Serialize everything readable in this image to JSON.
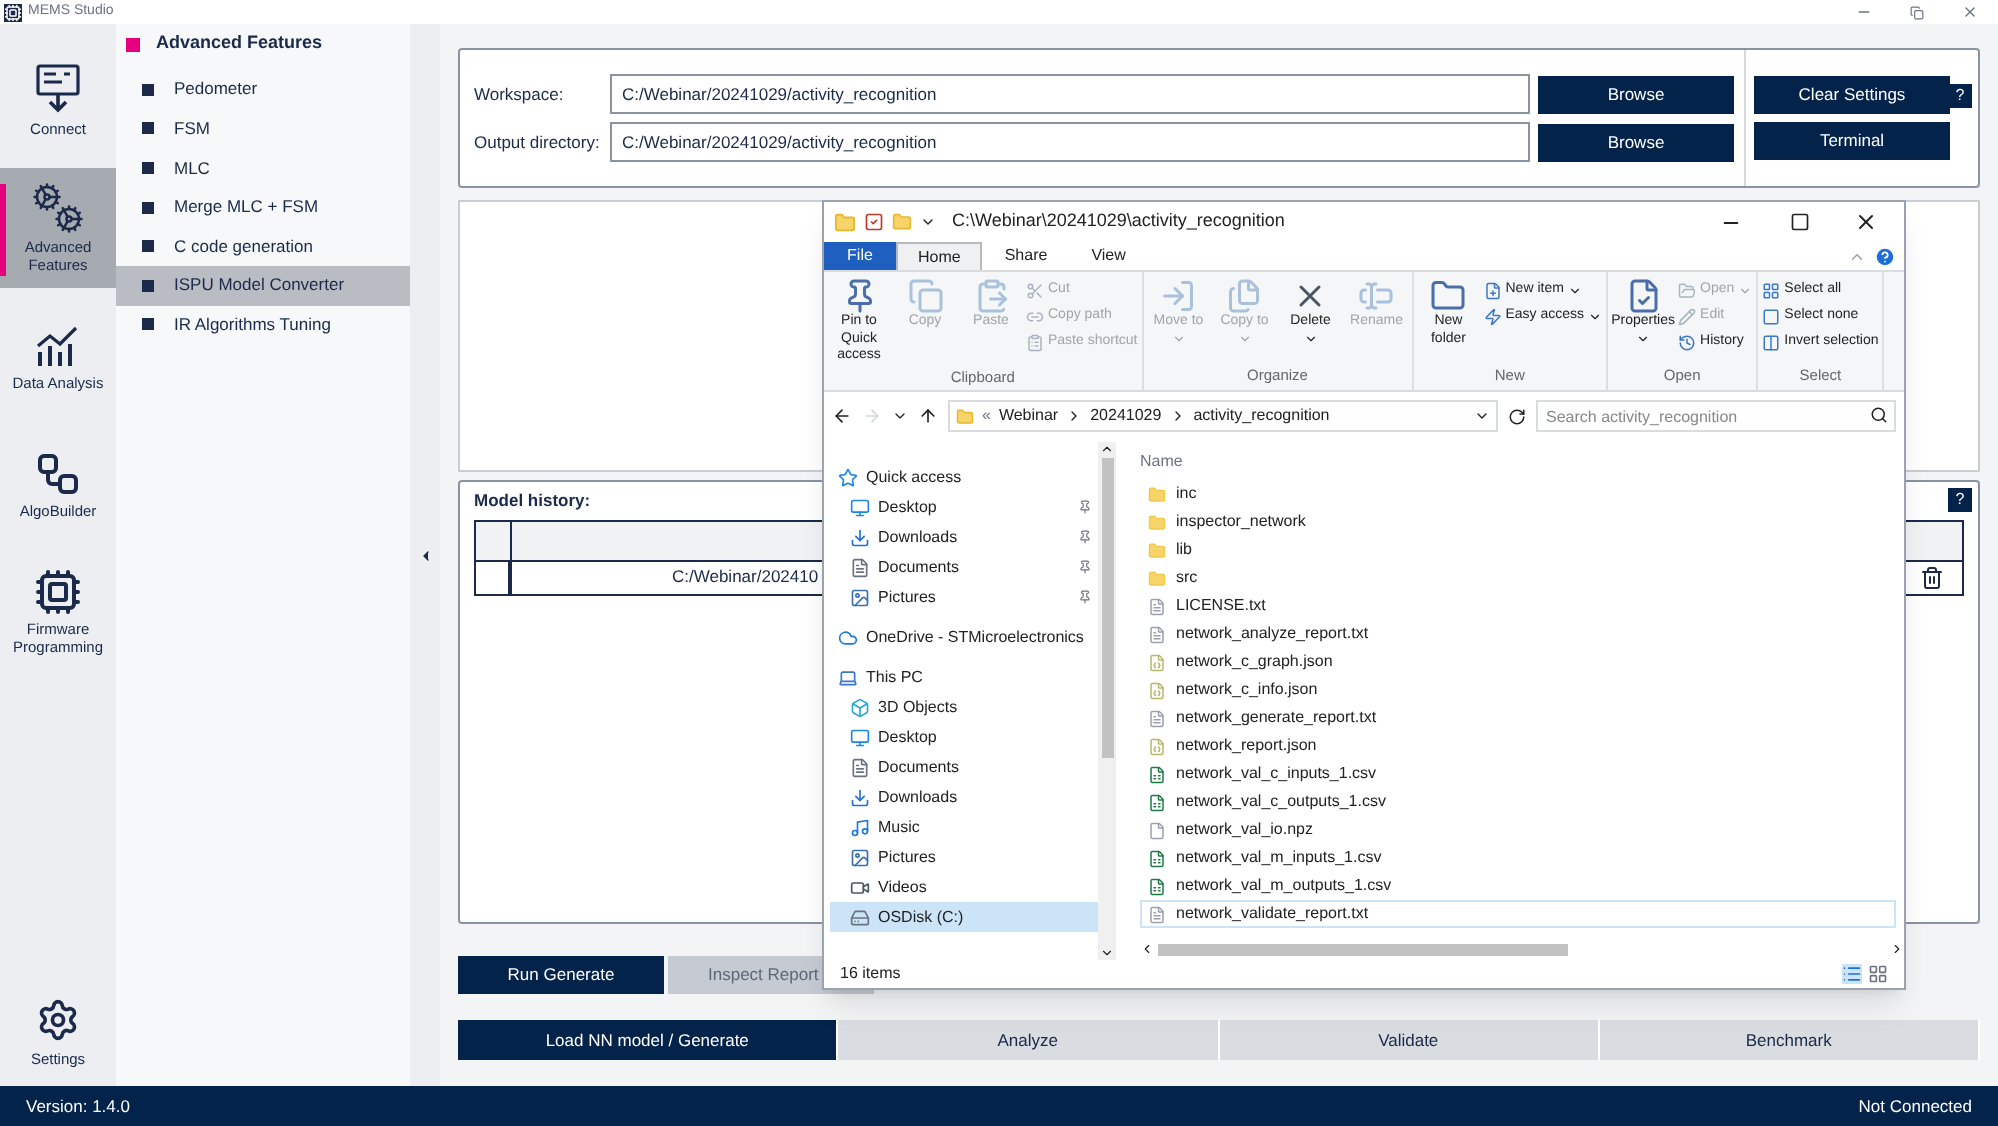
{
  "app_title": "MEMS Studio",
  "rail": [
    {
      "label": "Connect",
      "kind": "connect",
      "selected": false
    },
    {
      "label": "Advanced Features",
      "kind": "gears",
      "selected": true
    },
    {
      "label": "Data Analysis",
      "kind": "chart",
      "selected": false
    },
    {
      "label": "AlgoBuilder",
      "kind": "tree",
      "selected": false
    },
    {
      "label": "Firmware Programming",
      "kind": "chip",
      "selected": false
    }
  ],
  "settings": {
    "label": "Settings"
  },
  "submenu": {
    "title": "Advanced Features",
    "items": [
      {
        "label": "Pedometer",
        "selected": false
      },
      {
        "label": "FSM",
        "selected": false
      },
      {
        "label": "MLC",
        "selected": false
      },
      {
        "label": "Merge MLC + FSM",
        "selected": false
      },
      {
        "label": "C code generation",
        "selected": false
      },
      {
        "label": "ISPU Model Converter",
        "selected": true
      },
      {
        "label": "IR Algorithms Tuning",
        "selected": false
      }
    ]
  },
  "workspace": {
    "fields": [
      {
        "label": "Workspace:",
        "value": "C:/Webinar/20241029/activity_recognition",
        "button": "Browse"
      },
      {
        "label": "Output directory:",
        "value": "C:/Webinar/20241029/activity_recognition",
        "button": "Browse"
      }
    ],
    "side_buttons": [
      "Clear Settings",
      "Terminal"
    ],
    "help": "?"
  },
  "model_history": {
    "title": "Model history:",
    "help": "?",
    "rows": [
      {
        "path": "C:/Webinar/202410"
      }
    ]
  },
  "actions": [
    {
      "label": "Run Generate",
      "disabled": false
    },
    {
      "label": "Inspect Report",
      "disabled": true
    }
  ],
  "tabs": [
    {
      "label": "Load NN model / Generate",
      "selected": true
    },
    {
      "label": "Analyze",
      "selected": false
    },
    {
      "label": "Validate",
      "selected": false
    },
    {
      "label": "Benchmark",
      "selected": false
    }
  ],
  "status_bar": {
    "version": "Version: 1.4.0",
    "connection": "Not Connected"
  },
  "explorer": {
    "title": "C:\\Webinar\\20241029\\activity_recognition",
    "tabs": [
      {
        "label": "File",
        "kind": "menu"
      },
      {
        "label": "Home",
        "kind": "tab",
        "selected": true
      },
      {
        "label": "Share",
        "kind": "tab",
        "selected": false
      },
      {
        "label": "View",
        "kind": "tab",
        "selected": false
      }
    ],
    "ribbon": [
      {
        "label": "Clipboard",
        "items": [
          {
            "label": "Pin to Quick access",
            "kind": "large",
            "disabled": false,
            "dropdown": false
          },
          {
            "label": "Copy",
            "kind": "large",
            "disabled": true,
            "dropdown": false
          },
          {
            "label": "Paste",
            "kind": "large",
            "disabled": true,
            "dropdown": false
          },
          {
            "label": "Cut",
            "kind": "small",
            "disabled": true,
            "dropdown": false
          },
          {
            "label": "Copy path",
            "kind": "small",
            "disabled": true,
            "dropdown": false
          },
          {
            "label": "Paste shortcut",
            "kind": "small",
            "disabled": true,
            "dropdown": false
          }
        ]
      },
      {
        "label": "Organize",
        "items": [
          {
            "label": "Move to",
            "kind": "large",
            "disabled": true,
            "dropdown": true
          },
          {
            "label": "Copy to",
            "kind": "large",
            "disabled": true,
            "dropdown": true
          },
          {
            "label": "Delete",
            "kind": "large",
            "disabled": false,
            "dropdown": true
          },
          {
            "label": "Rename",
            "kind": "large",
            "disabled": true,
            "dropdown": false
          }
        ]
      },
      {
        "label": "New",
        "items": [
          {
            "label": "New folder",
            "kind": "large",
            "disabled": false,
            "dropdown": false
          },
          {
            "label": "New item",
            "kind": "small",
            "disabled": false,
            "dropdown": true
          },
          {
            "label": "Easy access",
            "kind": "small",
            "disabled": false,
            "dropdown": true
          }
        ]
      },
      {
        "label": "Open",
        "items": [
          {
            "label": "Properties",
            "kind": "large",
            "disabled": false,
            "dropdown": true
          },
          {
            "label": "Open",
            "kind": "small",
            "disabled": true,
            "dropdown": true
          },
          {
            "label": "Edit",
            "kind": "small",
            "disabled": true,
            "dropdown": false
          },
          {
            "label": "History",
            "kind": "small",
            "disabled": false,
            "dropdown": false
          }
        ]
      },
      {
        "label": "Select",
        "items": [
          {
            "label": "Select all",
            "kind": "small",
            "disabled": false,
            "dropdown": false
          },
          {
            "label": "Select none",
            "kind": "small",
            "disabled": false,
            "dropdown": false
          },
          {
            "label": "Invert selection",
            "kind": "small",
            "disabled": false,
            "dropdown": false
          }
        ]
      }
    ],
    "breadcrumb": [
      "«",
      "Webinar",
      "20241029",
      "activity_recognition"
    ],
    "search": {
      "placeholder": "Search activity_recognition"
    },
    "nav": [
      {
        "label": "Quick access",
        "kind": "star",
        "pinned": false,
        "selected": false
      },
      {
        "label": "Desktop",
        "kind": "desktop",
        "pinned": true,
        "selected": false
      },
      {
        "label": "Downloads",
        "kind": "download",
        "pinned": true,
        "selected": false
      },
      {
        "label": "Documents",
        "kind": "document",
        "pinned": true,
        "selected": false
      },
      {
        "label": "Pictures",
        "kind": "picture",
        "pinned": true,
        "selected": false
      },
      {
        "label": "OneDrive - STMicroelectronics",
        "kind": "cloud",
        "pinned": false,
        "selected": false
      },
      {
        "label": "This PC",
        "kind": "pc",
        "pinned": false,
        "selected": false
      },
      {
        "label": "3D Objects",
        "kind": "cube",
        "pinned": false,
        "selected": false
      },
      {
        "label": "Desktop",
        "kind": "desktop",
        "pinned": false,
        "selected": false
      },
      {
        "label": "Documents",
        "kind": "document",
        "pinned": false,
        "selected": false
      },
      {
        "label": "Downloads",
        "kind": "download",
        "pinned": false,
        "selected": false
      },
      {
        "label": "Music",
        "kind": "music",
        "pinned": false,
        "selected": false
      },
      {
        "label": "Pictures",
        "kind": "picture",
        "pinned": false,
        "selected": false
      },
      {
        "label": "Videos",
        "kind": "video",
        "pinned": false,
        "selected": false
      },
      {
        "label": "OSDisk (C:)",
        "kind": "disk",
        "pinned": false,
        "selected": true
      }
    ],
    "column": "Name",
    "files": [
      {
        "name": "inc",
        "kind": "folder",
        "selected": false
      },
      {
        "name": "inspector_network",
        "kind": "folder",
        "selected": false
      },
      {
        "name": "lib",
        "kind": "folder",
        "selected": false
      },
      {
        "name": "src",
        "kind": "folder",
        "selected": false
      },
      {
        "name": "LICENSE.txt",
        "kind": "text",
        "selected": false
      },
      {
        "name": "network_analyze_report.txt",
        "kind": "text",
        "selected": false
      },
      {
        "name": "network_c_graph.json",
        "kind": "json",
        "selected": false
      },
      {
        "name": "network_c_info.json",
        "kind": "json",
        "selected": false
      },
      {
        "name": "network_generate_report.txt",
        "kind": "text",
        "selected": false
      },
      {
        "name": "network_report.json",
        "kind": "json",
        "selected": false
      },
      {
        "name": "network_val_c_inputs_1.csv",
        "kind": "csv",
        "selected": false
      },
      {
        "name": "network_val_c_outputs_1.csv",
        "kind": "csv",
        "selected": false
      },
      {
        "name": "network_val_io.npz",
        "kind": "file",
        "selected": false
      },
      {
        "name": "network_val_m_inputs_1.csv",
        "kind": "csv",
        "selected": false
      },
      {
        "name": "network_val_m_outputs_1.csv",
        "kind": "csv",
        "selected": false
      },
      {
        "name": "network_validate_report.txt",
        "kind": "text",
        "selected": true
      }
    ],
    "status": "16 items"
  }
}
